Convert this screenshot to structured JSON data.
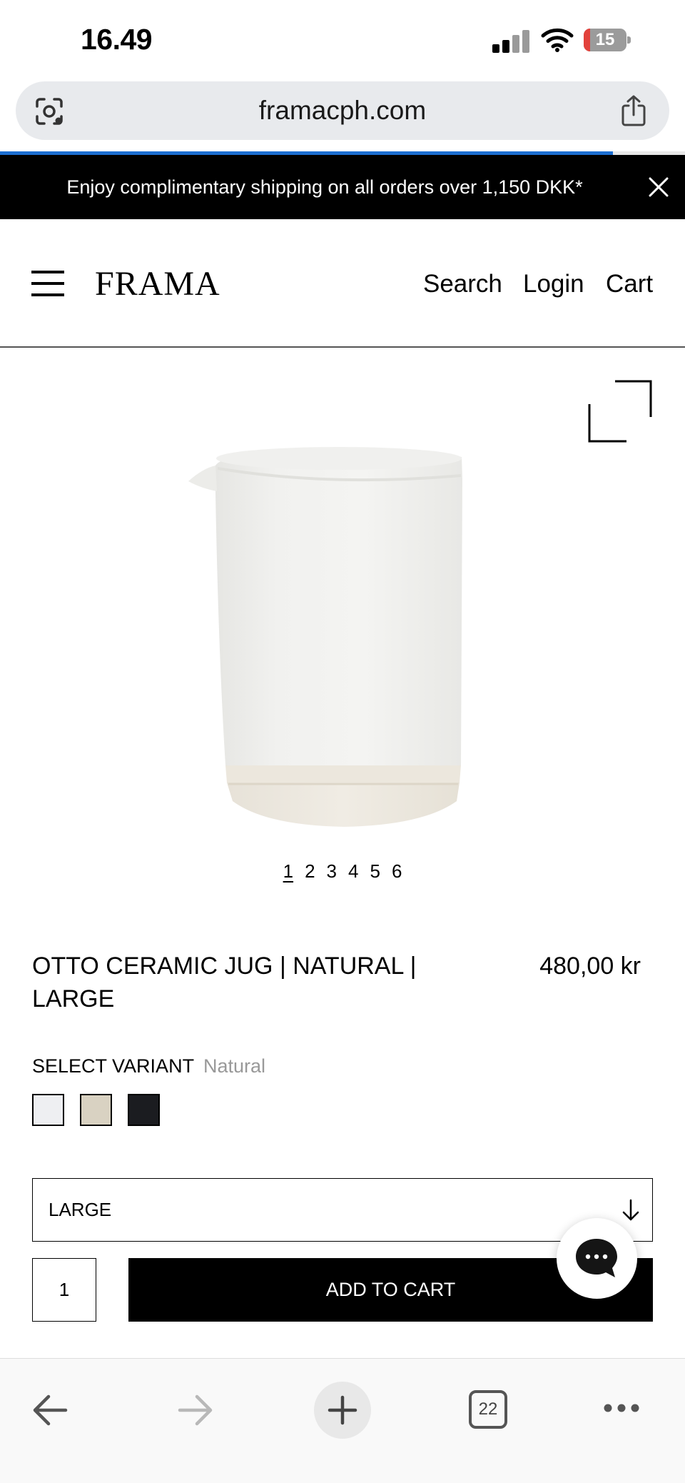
{
  "status_bar": {
    "time": "16.49",
    "battery_level": "15",
    "battery_fraction": 0.15,
    "battery_color": "#e2413b"
  },
  "browser": {
    "url": "framacph.com",
    "load_progress": 0.895,
    "progress_color": "#1d6fd1",
    "tab_count": "22",
    "icons": {
      "left": "screenshot-lens-icon",
      "right": "share-icon"
    }
  },
  "announcement": {
    "text": "Enjoy complimentary shipping on all orders over 1,150 DKK*"
  },
  "header": {
    "brand": "FRAMA",
    "nav": {
      "search": "Search",
      "login": "Login",
      "cart": "Cart"
    }
  },
  "gallery": {
    "pages": [
      "1",
      "2",
      "3",
      "4",
      "5",
      "6"
    ],
    "active_page": "1"
  },
  "product": {
    "title": "OTTO CERAMIC JUG | NATURAL | LARGE",
    "price": "480,00 kr",
    "variant_label": "SELECT VARIANT",
    "variant_value": "Natural",
    "swatches": [
      {
        "name": "white",
        "color": "#eeeff2"
      },
      {
        "name": "natural",
        "color": "#d9d2c2"
      },
      {
        "name": "black",
        "color": "#1b1c20"
      }
    ],
    "size": "LARGE",
    "quantity": "1",
    "add_to_cart": "ADD TO CART"
  }
}
